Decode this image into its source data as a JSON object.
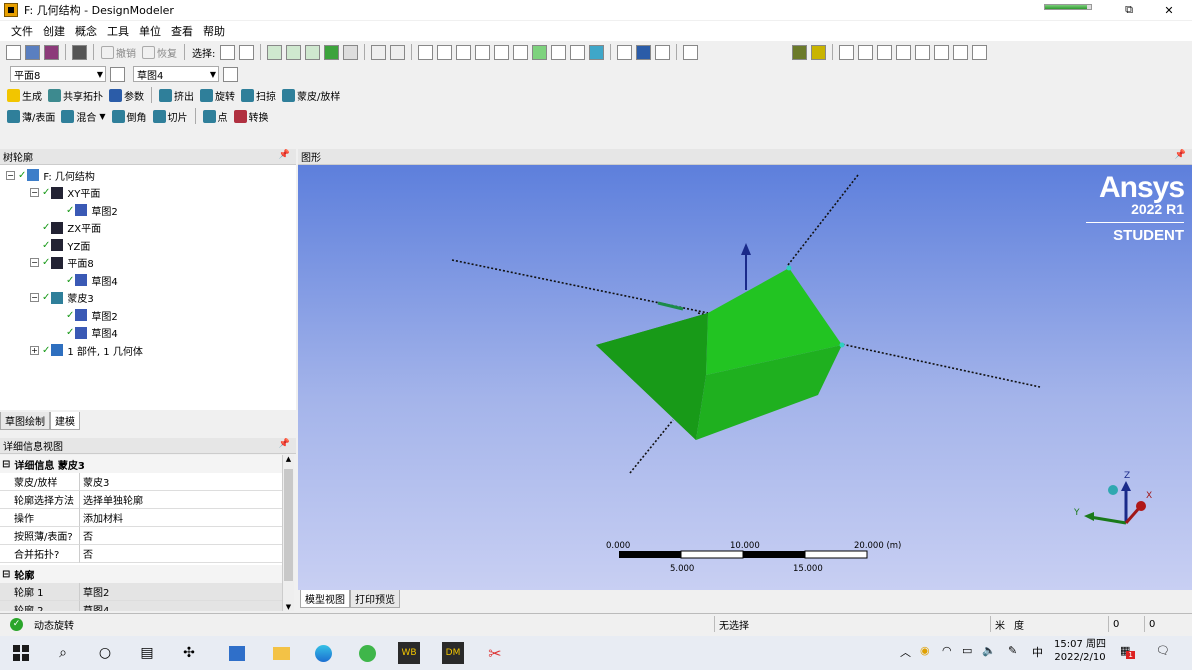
{
  "window": {
    "title": "F: 几何结构 - DesignModeler",
    "restore_glyph": "⧉",
    "close_glyph": "✕",
    "progress": 0.92
  },
  "menu": [
    "文件",
    "创建",
    "概念",
    "工具",
    "单位",
    "查看",
    "帮助"
  ],
  "toolbar1": {
    "undo": "撤销",
    "redo": "恢复",
    "select_label": "选择:"
  },
  "toolbar2": {
    "plane_value": "平面8",
    "sketch_value": "草图4"
  },
  "toolbar3": {
    "generate": "生成",
    "share_topo": "共享拓扑",
    "params": "参数",
    "extrude": "挤出",
    "revolve": "旋转",
    "sweep": "扫掠",
    "skin": "蒙皮/放样"
  },
  "toolbar4": {
    "thin": "薄/表面",
    "blend": "混合",
    "chamfer": "倒角",
    "slice": "切片",
    "point": "点",
    "convert": "转换"
  },
  "tree": {
    "header": "树轮廓",
    "nodes": [
      {
        "label": "F: 几何结构",
        "level": 0,
        "exp": "−",
        "icon": "geometry-icon"
      },
      {
        "label": "XY平面",
        "level": 1,
        "exp": "−",
        "icon": "plane-axes-icon"
      },
      {
        "label": "草图2",
        "level": 2,
        "exp": "",
        "icon": "sketch-icon"
      },
      {
        "label": "ZX平面",
        "level": 1,
        "exp": "",
        "icon": "plane-axes-icon"
      },
      {
        "label": "YZ面",
        "level": 1,
        "exp": "",
        "icon": "plane-axes-icon"
      },
      {
        "label": "平面8",
        "level": 1,
        "exp": "−",
        "icon": "plane-axes-icon"
      },
      {
        "label": "草图4",
        "level": 2,
        "exp": "",
        "icon": "sketch-icon"
      },
      {
        "label": "蒙皮3",
        "level": 1,
        "exp": "−",
        "icon": "skin-icon"
      },
      {
        "label": "草图2",
        "level": 2,
        "exp": "",
        "icon": "sketch-icon"
      },
      {
        "label": "草图4",
        "level": 2,
        "exp": "",
        "icon": "sketch-icon"
      },
      {
        "label": "1 部件, 1 几何体",
        "level": 1,
        "exp": "+",
        "icon": "body-icon"
      }
    ],
    "tabs": [
      "草图绘制",
      "建模"
    ]
  },
  "details": {
    "header": "详细信息视图",
    "section1": "详细信息 蒙皮3",
    "rows1": [
      {
        "k": "蒙皮/放样",
        "v": "蒙皮3"
      },
      {
        "k": "轮廓选择方法",
        "v": "选择单独轮廓"
      },
      {
        "k": "操作",
        "v": "添加材料"
      },
      {
        "k": "按照薄/表面?",
        "v": "否"
      },
      {
        "k": "合并拓扑?",
        "v": "否"
      }
    ],
    "section2": "轮廓",
    "rows2": [
      {
        "k": "轮廓 1",
        "v": "草图2"
      },
      {
        "k": "轮廓 2",
        "v": "草图4"
      }
    ]
  },
  "graphics": {
    "header": "图形",
    "brand": "Ansys",
    "version": "2022 R1",
    "edition": "STUDENT",
    "scale_labels_top": [
      "0.000",
      "10.000",
      "20.000 (m)"
    ],
    "scale_labels_bottom": [
      "5.000",
      "15.000"
    ],
    "view_tabs": [
      "模型视图",
      "打印预览"
    ],
    "triad": {
      "z": "Z",
      "y": "Y",
      "x": "X"
    },
    "colors": {
      "body_light": "#22c422",
      "body_dark": "#138a13"
    }
  },
  "status": {
    "message": "动态旋转",
    "selection": "无选择",
    "unit1": "米",
    "unit2": "度",
    "v1": "0",
    "v2": "0"
  },
  "taskbar": {
    "time": "15:07 周四",
    "date": "2022/2/10",
    "ime": "中",
    "notif_count": "1"
  }
}
